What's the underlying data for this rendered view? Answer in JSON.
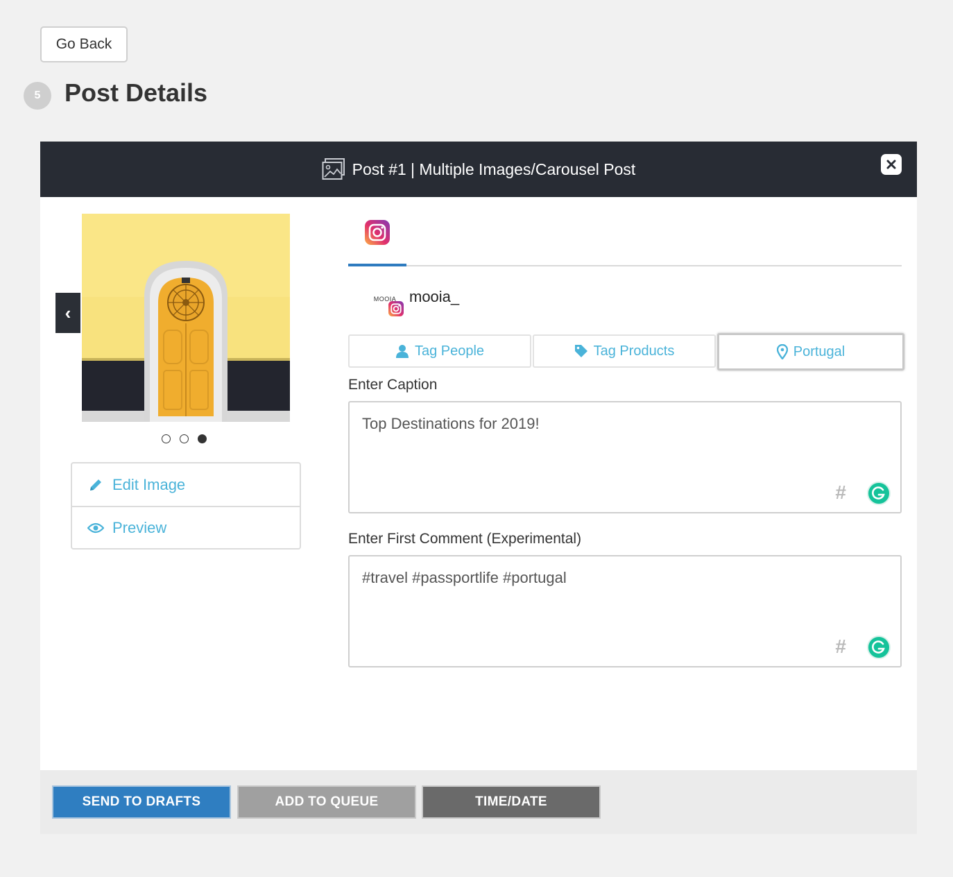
{
  "nav": {
    "go_back_label": "Go Back"
  },
  "section": {
    "step_number": "5",
    "title": "Post Details"
  },
  "post": {
    "header_title": "Post #1 | Multiple Images/Carousel Post",
    "carousel": {
      "total_images": 3,
      "active_index": 2
    },
    "image_actions": {
      "edit_label": "Edit Image",
      "preview_label": "Preview"
    },
    "platform_tab": "instagram-icon",
    "account": {
      "avatar_text": "MOOIA",
      "username": "mooia_"
    },
    "tags": {
      "people_label": "Tag People",
      "products_label": "Tag Products",
      "location_label": "Portugal"
    },
    "caption": {
      "label": "Enter Caption",
      "value": "Top Destinations for 2019!"
    },
    "first_comment": {
      "label": "Enter First Comment (Experimental)",
      "value": "#travel #passportlife #portugal"
    },
    "hashtag_symbol": "#"
  },
  "footer": {
    "send_to_drafts_label": "SEND TO DRAFTS",
    "add_to_queue_label": "ADD TO QUEUE",
    "time_date_label": "TIME/DATE"
  },
  "colors": {
    "primary_blue": "#2f7ec1",
    "link_blue": "#4ab3d9",
    "header_dark": "#282c34",
    "grammarly_green": "#15c39a"
  }
}
